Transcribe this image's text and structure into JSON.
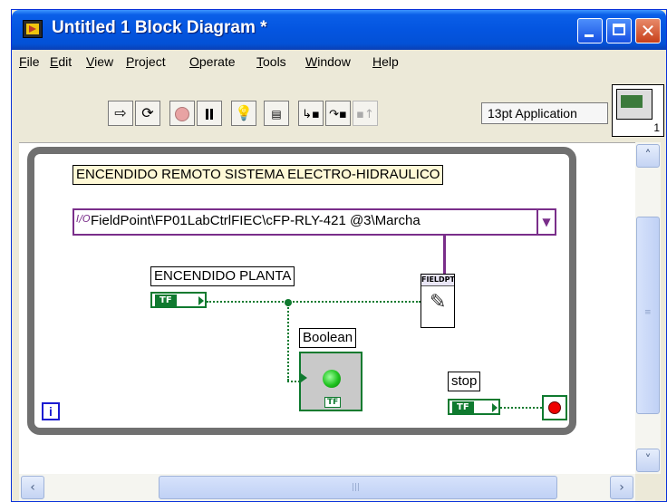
{
  "window": {
    "title": "Untitled 1 Block Diagram *"
  },
  "menu": [
    "File",
    "Edit",
    "View",
    "Project",
    "Operate",
    "Tools",
    "Window",
    "Help"
  ],
  "toolbar": {
    "tools": [
      "run-arrow",
      "run-continuously",
      "abort",
      "pause",
      "highlight-execution",
      "retain-wire-values",
      "step-into",
      "step-over",
      "step-out"
    ],
    "font": "13pt Application"
  },
  "connector_pane": {
    "number": "1"
  },
  "diagram": {
    "comment": "ENCENDIDO REMOTO SISTEMA ELECTRO-HIDRAULICO",
    "fieldpoint_io": "FieldPoint\\FP01LabCtrlFIEC\\cFP-RLY-421 @3\\Marcha",
    "fieldpoint_node_label": "FIELDPT",
    "encendido_label": "ENCENDIDO PLANTA",
    "boolean_label": "Boolean",
    "stop_label": "stop",
    "tf_text": "TF",
    "iteration_label": "i"
  },
  "colors": {
    "boolean_wire": "#0f7a2f",
    "refnum_wire": "#7a2e8a",
    "loop_border": "#707070"
  }
}
